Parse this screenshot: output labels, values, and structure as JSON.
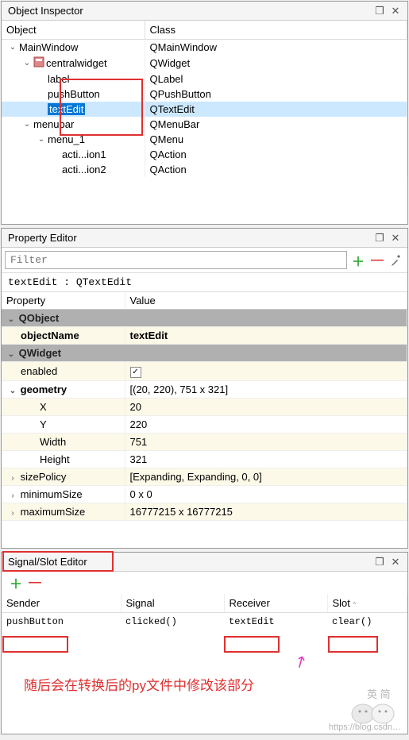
{
  "inspector": {
    "title": "Object Inspector",
    "col_object": "Object",
    "col_class": "Class",
    "rows": [
      {
        "name": "MainWindow",
        "class": "QMainWindow",
        "depth": 0,
        "exp": "v"
      },
      {
        "name": "centralwidget",
        "class": "QWidget",
        "depth": 1,
        "exp": "v",
        "icon": true
      },
      {
        "name": "label",
        "class": "QLabel",
        "depth": 2
      },
      {
        "name": "pushButton",
        "class": "QPushButton",
        "depth": 2
      },
      {
        "name": "textEdit",
        "class": "QTextEdit",
        "depth": 2,
        "selected": true
      },
      {
        "name": "menubar",
        "class": "QMenuBar",
        "depth": 1,
        "exp": "v"
      },
      {
        "name": "menu_1",
        "class": "QMenu",
        "depth": 2,
        "exp": "v"
      },
      {
        "name": "acti...ion1",
        "class": "QAction",
        "depth": 3
      },
      {
        "name": "acti...ion2",
        "class": "QAction",
        "depth": 3
      }
    ]
  },
  "propeditor": {
    "title": "Property Editor",
    "filter_placeholder": "Filter",
    "object_path": "textEdit : QTextEdit",
    "col_property": "Property",
    "col_value": "Value",
    "group1": "QObject",
    "objectName_label": "objectName",
    "objectName_value": "textEdit",
    "group2": "QWidget",
    "enabled_label": "enabled",
    "enabled_checked": "✓",
    "geometry_label": "geometry",
    "geometry_value": "[(20, 220), 751 x 321]",
    "x_label": "X",
    "x_value": "20",
    "y_label": "Y",
    "y_value": "220",
    "width_label": "Width",
    "width_value": "751",
    "height_label": "Height",
    "height_value": "321",
    "sizePolicy_label": "sizePolicy",
    "sizePolicy_value": "[Expanding, Expanding, 0, 0]",
    "minimumSize_label": "minimumSize",
    "minimumSize_value": "0 x 0",
    "maximumSize_label": "maximumSize",
    "maximumSize_value": "16777215 x 16777215"
  },
  "signalslot": {
    "title": "Signal/Slot Editor",
    "col_sender": "Sender",
    "col_signal": "Signal",
    "col_receiver": "Receiver",
    "col_slot": "Slot",
    "sender": "pushButton",
    "signal": "clicked()",
    "receiver": "textEdit",
    "slot": "clear()"
  },
  "annotation_text": "随后会在转换后的py文件中修改该部分",
  "watermark": "https://blog.csdn…",
  "mascot_label": "英 简"
}
